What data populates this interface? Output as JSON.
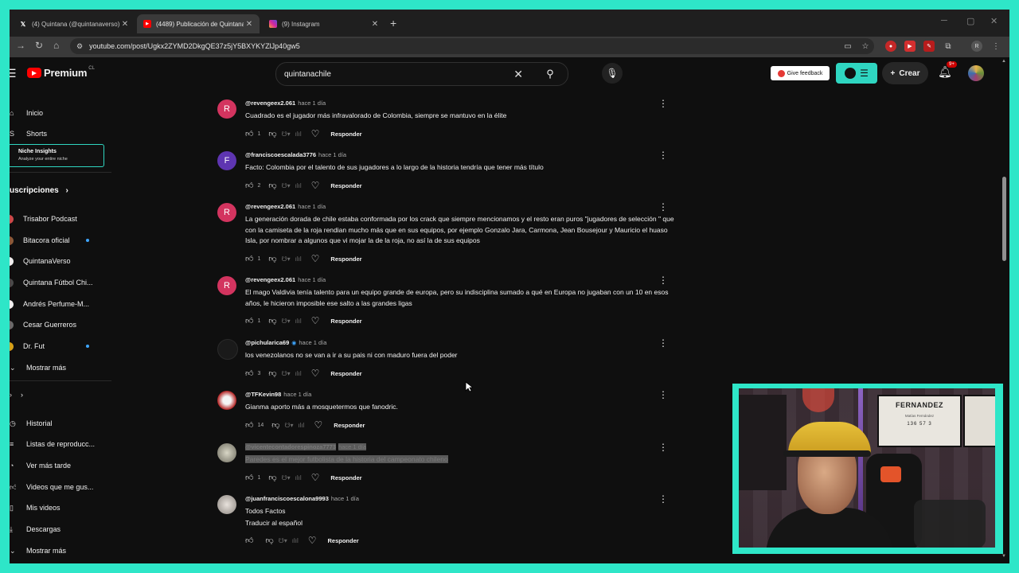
{
  "browser": {
    "tabs": [
      {
        "label": "(4) Quintana (@quintanaverso)",
        "icon": "x-logo-icon"
      },
      {
        "label": "(4489) Publicación de Quintana",
        "icon": "youtube-icon"
      },
      {
        "label": "(9) Instagram",
        "icon": "instagram-icon"
      }
    ],
    "url": "youtube.com/post/Ugkx2ZYMD2DkgQE37z5jY5BXYKYZlJp40gw5"
  },
  "header": {
    "logo_text": "Premium",
    "country": "CL",
    "search_value": "quintanachile",
    "feedback_label": "Give feedback",
    "create_label": "Crear",
    "notifications": "9+"
  },
  "sidebar": {
    "top": [
      {
        "label": "Inicio",
        "icon": "home-icon"
      },
      {
        "label": "Shorts",
        "icon": "shorts-icon"
      }
    ],
    "niche": {
      "title": "Niche Insights",
      "subtitle": "Analyze your entire niche"
    },
    "subscriptions_title": "uscripciones",
    "subscriptions": [
      {
        "label": "Trisabor Podcast",
        "live": false,
        "color": "#c94a4a"
      },
      {
        "label": "Bitacora oficial",
        "live": true,
        "color": "#8a5a3a"
      },
      {
        "label": "QuintanaVerso",
        "live": false,
        "color": "#eeeeee"
      },
      {
        "label": "Quintana Fútbol Chi...",
        "live": false,
        "color": "#4a4a4a"
      },
      {
        "label": "Andrés Perfume-M...",
        "live": false,
        "color": "#f0f0f0"
      },
      {
        "label": "Cesar Guerreros",
        "live": false,
        "color": "#6a6a6a"
      },
      {
        "label": "Dr. Fut",
        "live": true,
        "color": "#d4a11a"
      }
    ],
    "show_more": "Mostrar más",
    "you_items": [
      {
        "label": "Historial",
        "icon": "history-icon"
      },
      {
        "label": "Listas de reproducc...",
        "icon": "playlist-icon"
      },
      {
        "label": "Ver más tarde",
        "icon": "clock-icon"
      },
      {
        "label": "Videos que me gus...",
        "icon": "like-icon"
      },
      {
        "label": "Mis videos",
        "icon": "video-icon"
      },
      {
        "label": "Descargas",
        "icon": "download-icon"
      }
    ],
    "show_more_2": "Mostrar más"
  },
  "reply_label": "Responder",
  "translate_label": "Traducir al español",
  "comments": [
    {
      "user": "@revengeex2.061",
      "time": "hace 1 día",
      "text": "Cuadrado es el jugador más infravalorado de Colombia, siempre se mantuvo en la élite",
      "likes": "1",
      "avatar": "R",
      "avatar_color": "#d3345f"
    },
    {
      "user": "@franciscoescalada3776",
      "time": "hace 1 día",
      "text": "Facto: Colombia por el talento de sus jugadores a lo largo de la historia tendría que tener más título",
      "likes": "2",
      "avatar": "F",
      "avatar_color": "#5e35b1"
    },
    {
      "user": "@revengeex2.061",
      "time": "hace 1 día",
      "text": "La generación dorada de chile estaba conformada por los crack que siempre mencionamos y el resto eran puros \"jugadores de selección \" que con la camiseta de la roja rendian mucho más que en sus equipos, por ejemplo Gonzalo Jara, Carmona, Jean Bousejour y Mauricio el huaso Isla, por nombrar a algunos que vi mojar la de la roja, no así la de sus equipos",
      "likes": "1",
      "avatar": "R",
      "avatar_color": "#d3345f"
    },
    {
      "user": "@revengeex2.061",
      "time": "hace 1 día",
      "text": "El mago Valdivia tenía talento para un equipo grande de europa, pero su indisciplina sumado a qué en Europa no jugaban con un 10 en esos años, le hicieron imposible ese salto a las grandes ligas",
      "likes": "1",
      "avatar": "R",
      "avatar_color": "#d3345f"
    },
    {
      "user": "@pichularica69",
      "time": "hace 1 día",
      "text": "los venezolanos no se van a ir a su pais ni con maduro fuera del poder",
      "likes": "3",
      "avatar": "",
      "avatar_color": "#1a1a1a"
    },
    {
      "user": "@TFKevin98",
      "time": "hace 1 día",
      "text": "Gianma aporto más a mosquetermos que fanodric.",
      "likes": "14",
      "avatar": "",
      "avatar_color": "#b22222"
    },
    {
      "user": "@vicentecontadorespinoza7773",
      "time": "hace 1 día",
      "text": "Paredes es el mejor futbolista de la historia del campeonato chileno",
      "likes": "1",
      "avatar": "",
      "avatar_color": "#8a8a7a"
    },
    {
      "user": "@juanfranciscoescalona9993",
      "time": "hace 1 día",
      "text": "Todos Factos",
      "likes": "",
      "avatar": "",
      "avatar_color": "#cfcfcf"
    }
  ],
  "webcam": {
    "poster_name": "FERNANDEZ",
    "poster_sub": "Matías Fernández",
    "poster_nums": "136 57 3"
  }
}
